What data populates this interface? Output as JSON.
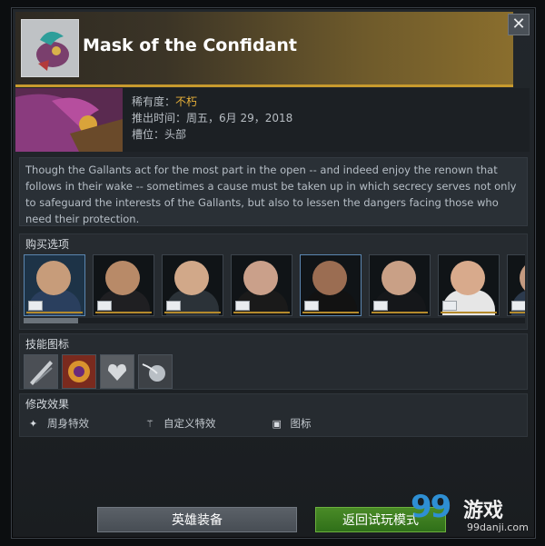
{
  "item": {
    "title": "Mask of the Confidant",
    "rarity_label": "稀有度：",
    "rarity_value": "不朽",
    "release_label": "推出时间：",
    "release_value": "周五，6月 29，2018",
    "slot_label": "槽位：",
    "slot_value": "头部",
    "description": "Though the Gallants act for the most part in the open -- and indeed enjoy the renown that follows in their wake -- sometimes a cause must be taken up in which secrecy serves not only to safeguard the interests of the Gallants, but also to lessen the dangers facing those who need their protection."
  },
  "sections": {
    "buy": "购买选项",
    "abilities": "技能图标",
    "modifications": "修改效果"
  },
  "mods": [
    {
      "label": "周身特效",
      "icon": "sparkle-icon"
    },
    {
      "label": "自定义特效",
      "icon": "wand-icon"
    },
    {
      "label": "图标",
      "icon": "cube-icon"
    }
  ],
  "buttons": {
    "hero_gear": "英雄装备",
    "back_demo": "返回试玩模式"
  },
  "close_icon": "close-icon",
  "watermark": {
    "num": "99",
    "text": "游戏",
    "url": "99danji.com"
  },
  "colors": {
    "rarity": "#e4ae39",
    "accent_gold": "#c79a2e",
    "demo_button": "#3f7f20"
  }
}
